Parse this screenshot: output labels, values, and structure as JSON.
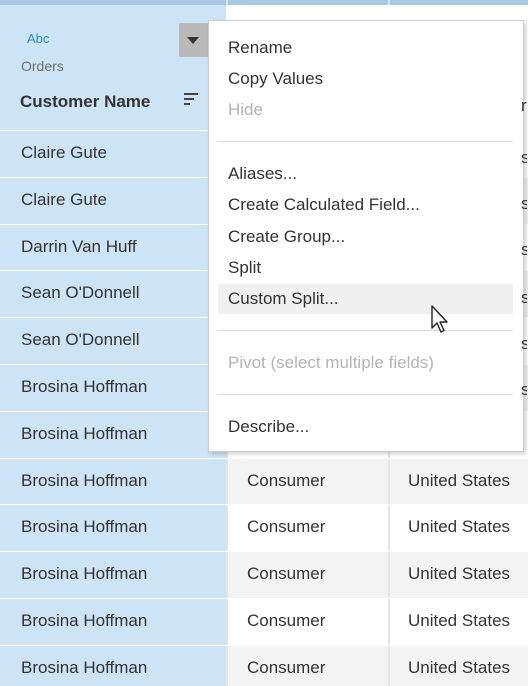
{
  "field": {
    "type_badge": "Abc",
    "source": "Orders",
    "title": "Customer Name"
  },
  "rows": [
    {
      "customer": "Claire Gute",
      "segment": "",
      "country": ""
    },
    {
      "customer": "Claire Gute",
      "segment": "",
      "country": ""
    },
    {
      "customer": "Darrin Van Huff",
      "segment": "",
      "country": ""
    },
    {
      "customer": "Sean O'Donnell",
      "segment": "",
      "country": ""
    },
    {
      "customer": "Sean O'Donnell",
      "segment": "",
      "country": ""
    },
    {
      "customer": "Brosina Hoffman",
      "segment": "",
      "country": ""
    },
    {
      "customer": "Brosina Hoffman",
      "segment": "",
      "country": ""
    },
    {
      "customer": "Brosina Hoffman",
      "segment": "Consumer",
      "country": "United States"
    },
    {
      "customer": "Brosina Hoffman",
      "segment": "Consumer",
      "country": "United States"
    },
    {
      "customer": "Brosina Hoffman",
      "segment": "Consumer",
      "country": "United States"
    },
    {
      "customer": "Brosina Hoffman",
      "segment": "Consumer",
      "country": "United States"
    },
    {
      "customer": "Brosina Hoffman",
      "segment": "Consumer",
      "country": "United States"
    }
  ],
  "context_menu": {
    "rename": "Rename",
    "copy_values": "Copy Values",
    "hide": "Hide",
    "aliases": "Aliases...",
    "create_calculated_field": "Create Calculated Field...",
    "create_group": "Create Group...",
    "split": "Split",
    "custom_split": "Custom Split...",
    "pivot": "Pivot (select multiple fields)",
    "describe": "Describe..."
  },
  "icons": {
    "dropdown": "chevron-down-icon",
    "sort": "sort-icon",
    "cursor": "mouse-pointer-icon"
  },
  "colors": {
    "selected_column": "#cde3f6",
    "type_badge": "#2a8fd0",
    "disabled_text": "#b4b4b4"
  }
}
